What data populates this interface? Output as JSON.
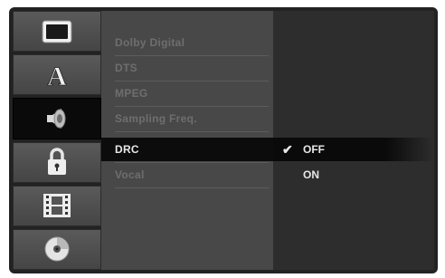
{
  "sidebar": {
    "items": [
      {
        "icon": "tv-screen-icon"
      },
      {
        "icon": "language-a-icon",
        "glyph": "A"
      },
      {
        "icon": "speaker-audio-icon"
      },
      {
        "icon": "padlock-icon"
      },
      {
        "icon": "film-strip-icon"
      },
      {
        "icon": "disc-icon"
      }
    ],
    "active_index": 2
  },
  "menu": {
    "items": [
      {
        "label": "Dolby Digital"
      },
      {
        "label": "DTS"
      },
      {
        "label": "MPEG"
      },
      {
        "label": "Sampling Freq."
      },
      {
        "label": "DRC"
      },
      {
        "label": "Vocal"
      }
    ],
    "selected_index": 4
  },
  "options": {
    "items": [
      {
        "label": "OFF",
        "checked": true
      },
      {
        "label": "ON",
        "checked": false
      }
    ],
    "check_glyph": "✔"
  },
  "colors": {
    "frame": "#222222",
    "menu_bg": "#484848",
    "menu_text_dim": "#6e6e6e",
    "text_bright": "#e8e8e8",
    "highlight": "#0a0a0a"
  }
}
